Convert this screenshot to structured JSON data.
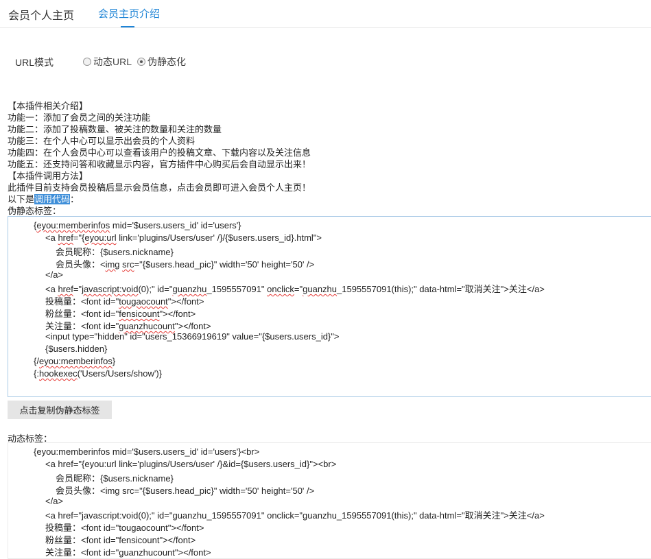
{
  "tabs": [
    {
      "label": "会员个人主页"
    },
    {
      "label": "会员主页介绍"
    }
  ],
  "url_mode": {
    "label": "URL模式",
    "options": [
      "动态URL",
      "伪静态化"
    ],
    "selected": "伪静态化"
  },
  "intro": {
    "lines": [
      "【本插件相关介绍】",
      "功能一：添加了会员之间的关注功能",
      "功能二：添加了投稿数量、被关注的数量和关注的数量",
      "功能三：在个人中心可以显示出会员的个人资料",
      "功能四：在个人会员中心可以查看该用户的投稿文章、下载内容以及关注信息",
      "功能五：还支持问答和收藏显示内容，官方插件中心购买后会自动显示出来！",
      "【本插件调用方法】",
      "此插件目前支持会员投稿后显示会员信息，点击会员即可进入会员个人主页！"
    ],
    "code_intro_prefix": "以下是",
    "code_intro_highlight": "调用代码",
    "code_intro_suffix": "：",
    "static_label": "伪静态标签："
  },
  "static_code": {
    "l1_a": "{",
    "l1_u": "eyou:memberinfos",
    "l1_b": " mid='$users.users_id' id='users'}",
    "l2_a": "<a ",
    "l2_u1": "href",
    "l2_b": "=\"{",
    "l2_u2": "eyou:url",
    "l2_c": " link='plugins/Users/user' /}/{$users.users_id}.html\">",
    "l3": "会员昵称：{$users.nickname}",
    "l4_a": "会员头像：<",
    "l4_u1": "img",
    "l4_b": " ",
    "l4_u2": "src",
    "l4_c": "=\"{$users.head_pic}\" width='50' height='50' />",
    "l5": "</a>",
    "l6_a": "<a ",
    "l6_u1": "href",
    "l6_b": "=\"",
    "l6_u2": "javascript:void",
    "l6_c": "(0);\" id=\"",
    "l6_u3": "guanzhu",
    "l6_d": "_1595557091\" ",
    "l6_u4": "onclick",
    "l6_e": "=\"",
    "l6_u5": "guanzhu",
    "l6_f": "_1595557091(this);\" data-html=\"取消关注\">关注</a>",
    "l7_a": "投稿量：<font id=\"",
    "l7_u": "tougaocount",
    "l7_b": "\"></font>",
    "l8_a": "粉丝量：<font id=\"",
    "l8_u": "fensicount",
    "l8_b": "\"></font>",
    "l9_a": "关注量：<font id=\"",
    "l9_u": "guanzhucount",
    "l9_b": "\"></font>",
    "l10": "<input type=\"hidden\" id=\"users_15366919619\" value=\"{$users.users_id}\">",
    "l11": "{$users.hidden}",
    "l12_a": "{/",
    "l12_u": "eyou:memberinfos",
    "l12_b": "}",
    "l13_a": "{:",
    "l13_u": "hookexec",
    "l13_b": "('Users/Users/show')}"
  },
  "copy_button": "点击复制伪静态标签",
  "dynamic_label": "动态标签：",
  "dynamic_code": {
    "l1": "{eyou:memberinfos mid='$users.users_id' id='users'}<br>",
    "l2": "<a href=\"{eyou:url link='plugins/Users/user' /}&id={$users.users_id}\"><br>",
    "l3": "会员昵称：{$users.nickname}",
    "l4": "会员头像：<img src=\"{$users.head_pic}\" width='50' height='50' />",
    "l5": "</a>",
    "l6": "<a href=\"javascript:void(0);\" id=\"guanzhu_1595557091\" onclick=\"guanzhu_1595557091(this);\" data-html=\"取消关注\">关注</a>",
    "l7": "投稿量：<font id=\"tougaocount\"></font>",
    "l8": "粉丝量：<font id=\"fensicount\"></font>",
    "l9": "关注量：<font id=\"guanzhucount\"></font>"
  },
  "colors": {
    "accent": "#1e84d6",
    "highlight": "#3f8fd9",
    "button_bg": "#e5e5e5"
  }
}
